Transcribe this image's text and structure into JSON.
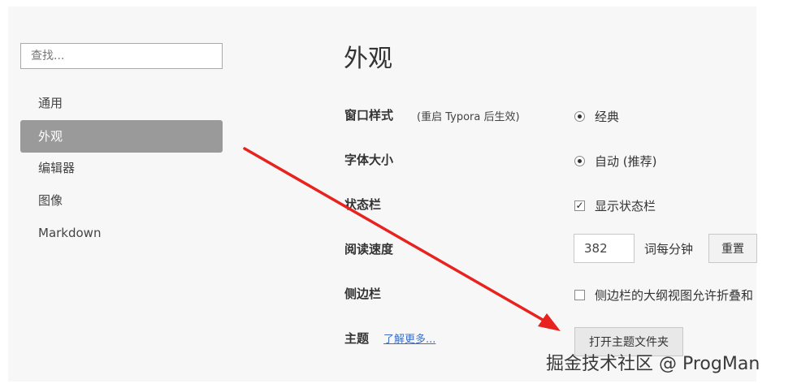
{
  "sidebar": {
    "search_placeholder": "查找...",
    "items": [
      {
        "label": "通用",
        "active": false
      },
      {
        "label": "外观",
        "active": true
      },
      {
        "label": "编辑器",
        "active": false
      },
      {
        "label": "图像",
        "active": false
      },
      {
        "label": "Markdown",
        "active": false
      }
    ]
  },
  "main": {
    "title": "外观",
    "window_style": {
      "label": "窗口样式",
      "note": "(重启 Typora 后生效)",
      "option": "经典",
      "selected": true
    },
    "font_size": {
      "label": "字体大小",
      "option": "自动 (推荐)",
      "selected": true
    },
    "status_bar": {
      "label": "状态栏",
      "option": "显示状态栏",
      "checked": true
    },
    "reading_speed": {
      "label": "阅读速度",
      "value": "382",
      "unit": "词每分钟",
      "reset_button": "重置"
    },
    "sidebar_setting": {
      "label": "侧边栏",
      "option": "侧边栏的大纲视图允许折叠和",
      "checked": false
    },
    "theme": {
      "label": "主题",
      "link": "了解更多...",
      "open_folder_button": "打开主题文件夹"
    }
  },
  "colors": {
    "active_nav_bg": "#9a9a9a",
    "link": "#3d6fc5",
    "annotation_arrow": "#e8221e"
  },
  "watermark": "掘金技术社区 @ ProgMan"
}
